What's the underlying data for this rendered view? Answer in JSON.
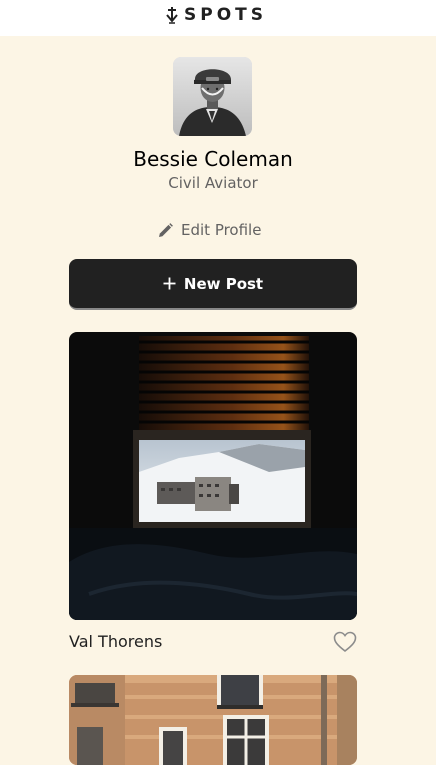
{
  "header": {
    "logo_text": "SPOTS",
    "logo_icon": "down-arrow-logo-icon"
  },
  "profile": {
    "name": "Bessie Coleman",
    "description": "Civil Aviator",
    "avatar_alt": "Bessie Coleman",
    "edit_label": "Edit Profile",
    "edit_icon": "pencil-icon"
  },
  "actions": {
    "new_post_label": "New Post",
    "new_post_icon": "plus-icon"
  },
  "cards": [
    {
      "title": "Val Thorens",
      "like_icon": "heart-outline-icon",
      "liked": false
    },
    {
      "title": "",
      "like_icon": "heart-outline-icon",
      "liked": false
    }
  ],
  "colors": {
    "background": "#fcf5e5",
    "header": "#ffffff",
    "button": "#212121",
    "secondary_text": "#636262"
  }
}
